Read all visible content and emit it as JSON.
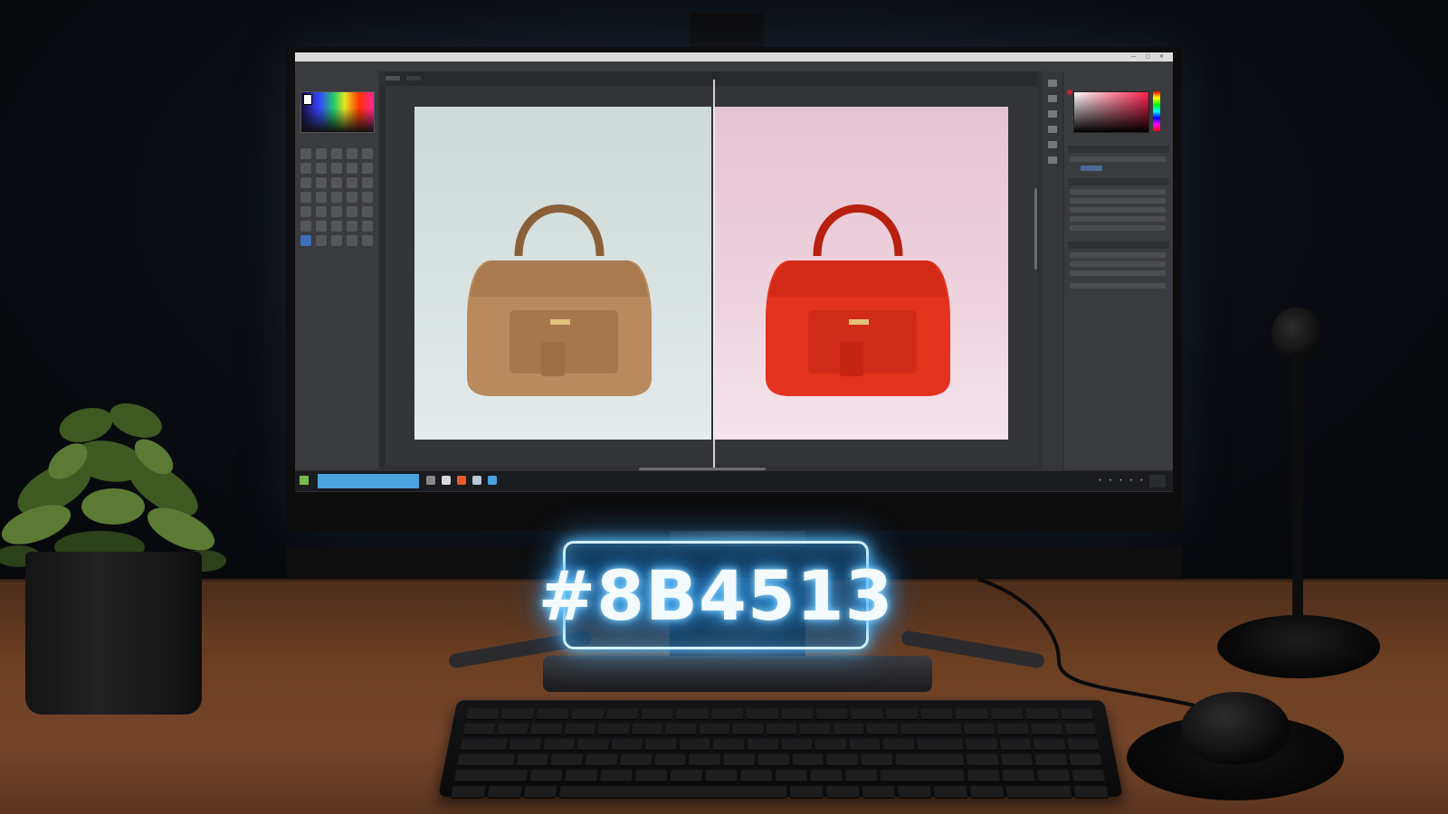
{
  "overlay": {
    "hex_code": "#8B4513"
  },
  "app": {
    "title": "",
    "menu": [
      "",
      "",
      "",
      "",
      ""
    ],
    "tabs": [
      "",
      ""
    ]
  },
  "panels": {
    "left_label": "",
    "right_label": ""
  },
  "canvas": {
    "before_bag_color": "#b98a5c",
    "after_bag_color": "#e3321d",
    "before_bg": "#d6e0de",
    "after_bg": "#ecc9d7"
  },
  "taskbar": {
    "search_text": ""
  },
  "colors": {
    "overlay_glow": "#41b4ff",
    "accent": "#3d6fb8"
  }
}
